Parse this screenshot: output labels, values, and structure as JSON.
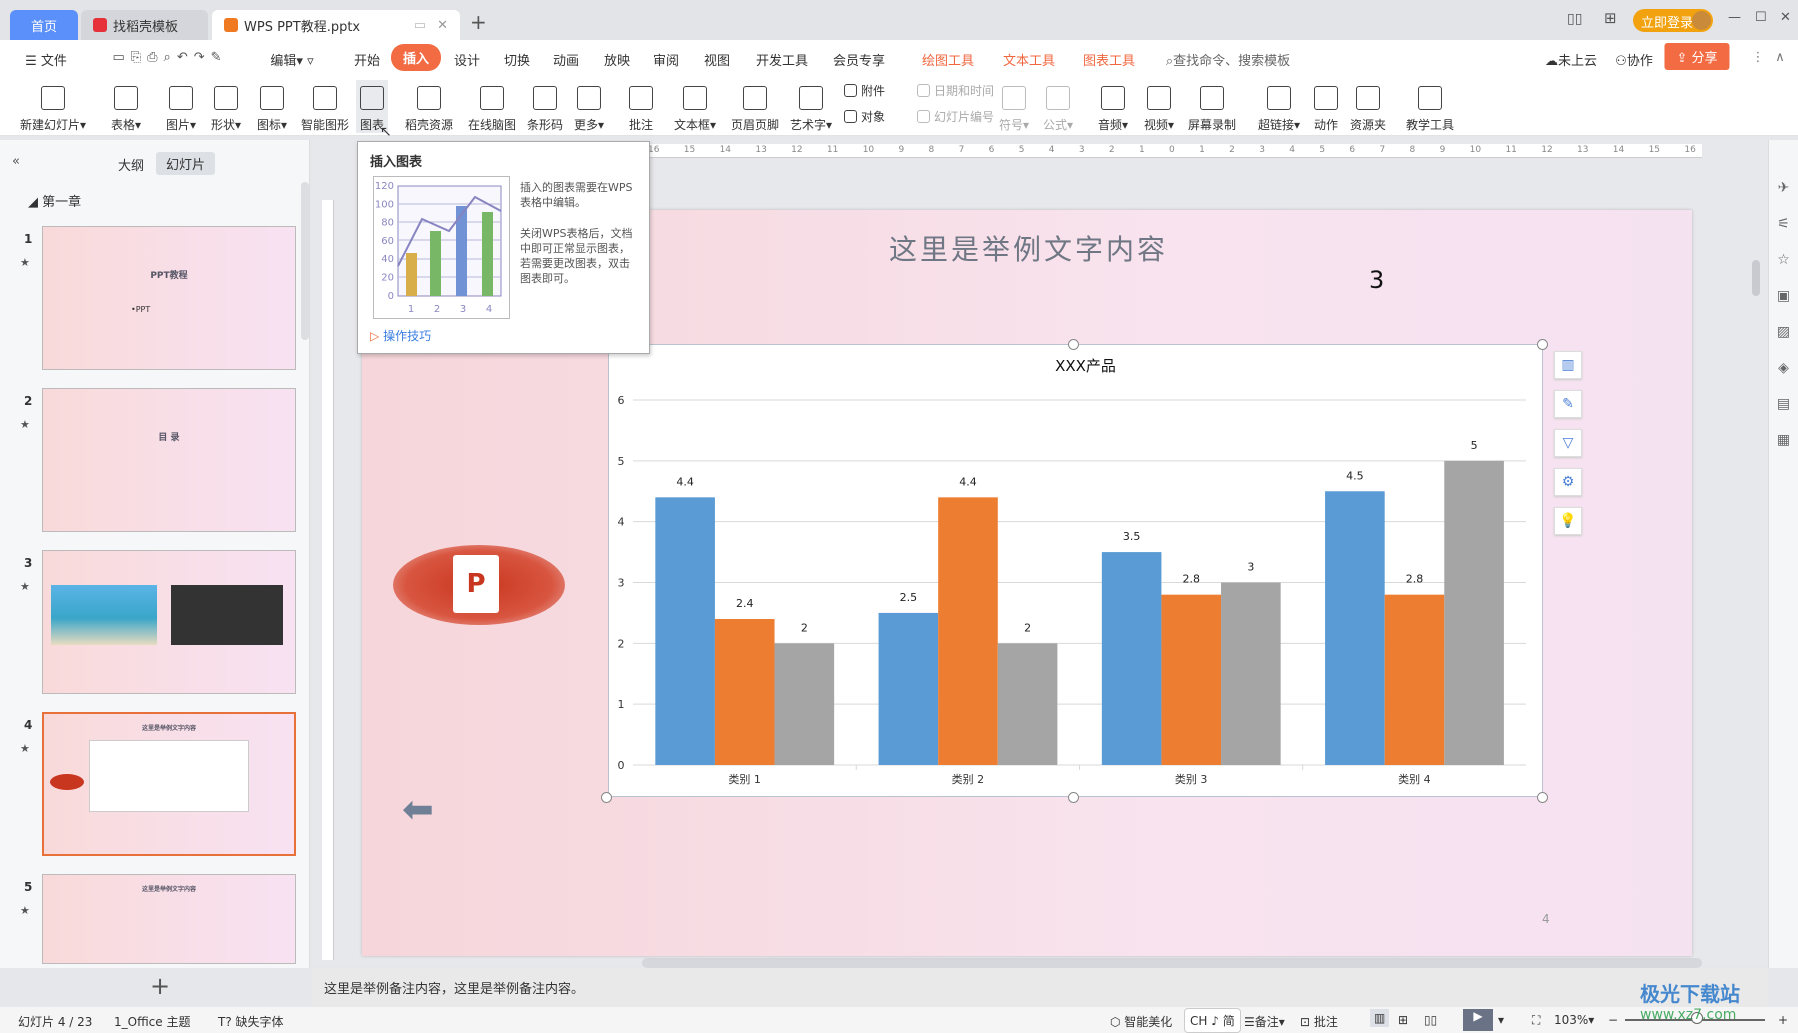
{
  "tabs": {
    "home": "首页",
    "template": "找稻壳模板",
    "doc": "WPS PPT教程.pptx",
    "new_tab": "+",
    "login": "立即登录"
  },
  "menu": {
    "file": "文件",
    "edit": "编辑",
    "items": [
      "开始",
      "插入",
      "设计",
      "切换",
      "动画",
      "放映",
      "审阅",
      "视图",
      "开发工具",
      "会员专享"
    ],
    "contextual": [
      "绘图工具",
      "文本工具",
      "图表工具"
    ],
    "search": "查找命令、搜索模板",
    "cloud": "未上云",
    "collab": "协作",
    "share": "分享",
    "active": "插入"
  },
  "ribbon": [
    {
      "label": "新建幻灯片▾",
      "icon": "new-slide"
    },
    {
      "label": "表格▾",
      "icon": "table"
    },
    {
      "label": "图片▾",
      "icon": "picture"
    },
    {
      "label": "形状▾",
      "icon": "shape"
    },
    {
      "label": "图标▾",
      "icon": "icons"
    },
    {
      "label": "智能图形",
      "icon": "smart-art"
    },
    {
      "label": "图表",
      "icon": "chart"
    },
    {
      "label": "稻壳资源",
      "icon": "docer"
    },
    {
      "label": "在线脑图",
      "icon": "mindmap"
    },
    {
      "label": "条形码",
      "icon": "barcode"
    },
    {
      "label": "更多▾",
      "icon": "more"
    },
    {
      "label": "批注",
      "icon": "comment"
    },
    {
      "label": "文本框▾",
      "icon": "textbox"
    },
    {
      "label": "页眉页脚",
      "icon": "header-footer"
    },
    {
      "label": "艺术字▾",
      "icon": "wordart"
    },
    {
      "label": "对象",
      "icon": "object",
      "small": true
    },
    {
      "label": "附件",
      "icon": "attachment",
      "small": true
    },
    {
      "label": "幻灯片编号",
      "icon": "slide-number",
      "small": true,
      "dim": true
    },
    {
      "label": "日期和时间",
      "icon": "datetime",
      "small": true,
      "dim": true
    },
    {
      "label": "符号▾",
      "icon": "symbol",
      "dim": true
    },
    {
      "label": "公式▾",
      "icon": "formula",
      "dim": true
    },
    {
      "label": "音频▾",
      "icon": "audio"
    },
    {
      "label": "视频▾",
      "icon": "video"
    },
    {
      "label": "屏幕录制",
      "icon": "screen-record"
    },
    {
      "label": "超链接▾",
      "icon": "hyperlink"
    },
    {
      "label": "动作",
      "icon": "action"
    },
    {
      "label": "资源夹",
      "icon": "resource-folder"
    },
    {
      "label": "教学工具",
      "icon": "teaching-tools"
    }
  ],
  "tooltip": {
    "title": "插入图表",
    "text1": "插入的图表需要在WPS表格中编辑。",
    "text2": "关闭WPS表格后，文档中即可正常显示图表，若需要更改图表，双击图表即可。",
    "link": "操作技巧",
    "yticks": [
      "120",
      "100",
      "80",
      "60",
      "40",
      "20",
      "0"
    ],
    "xticks": [
      "1",
      "2",
      "3",
      "4"
    ]
  },
  "panel": {
    "outline": "大纲",
    "slides": "幻灯片",
    "section": "第一章",
    "thumbs": [
      {
        "num": "1",
        "title": "PPT教程",
        "sub": "•PPT"
      },
      {
        "num": "2",
        "title": "目 录"
      },
      {
        "num": "3"
      },
      {
        "num": "4",
        "title": "这里是举例文字内容"
      },
      {
        "num": "5",
        "title": "这里是举例文字内容"
      }
    ]
  },
  "slide": {
    "title": "这里是举例文字内容",
    "number_text": "3",
    "page": "4"
  },
  "chart_data": {
    "type": "bar",
    "title": "XXX产品",
    "categories": [
      "类别 1",
      "类别 2",
      "类别 3",
      "类别 4"
    ],
    "series": [
      {
        "values": [
          4.4,
          2.5,
          3.5,
          4.5
        ],
        "color": "#5b9bd5"
      },
      {
        "values": [
          2.4,
          4.4,
          2.8,
          2.8
        ],
        "color": "#ed7d31"
      },
      {
        "values": [
          2,
          2,
          3,
          5
        ],
        "color": "#a5a5a5"
      }
    ],
    "ylim": [
      0,
      6
    ],
    "yticks": [
      0,
      1,
      2,
      3,
      4,
      5,
      6
    ],
    "grid": true,
    "data_labels": true
  },
  "notes": "这里是举例备注内容，这里是举例备注内容。",
  "status": {
    "slide": "幻灯片 4 / 23",
    "theme": "1_Office 主题",
    "font": "缺失字体",
    "smart": "智能美化",
    "ime": "CH ♪ 简",
    "notes": "备注▾",
    "comment": "批注",
    "zoom": "103%▾"
  },
  "watermark": {
    "name": "极光下载站",
    "url": "www.xz7.com"
  }
}
